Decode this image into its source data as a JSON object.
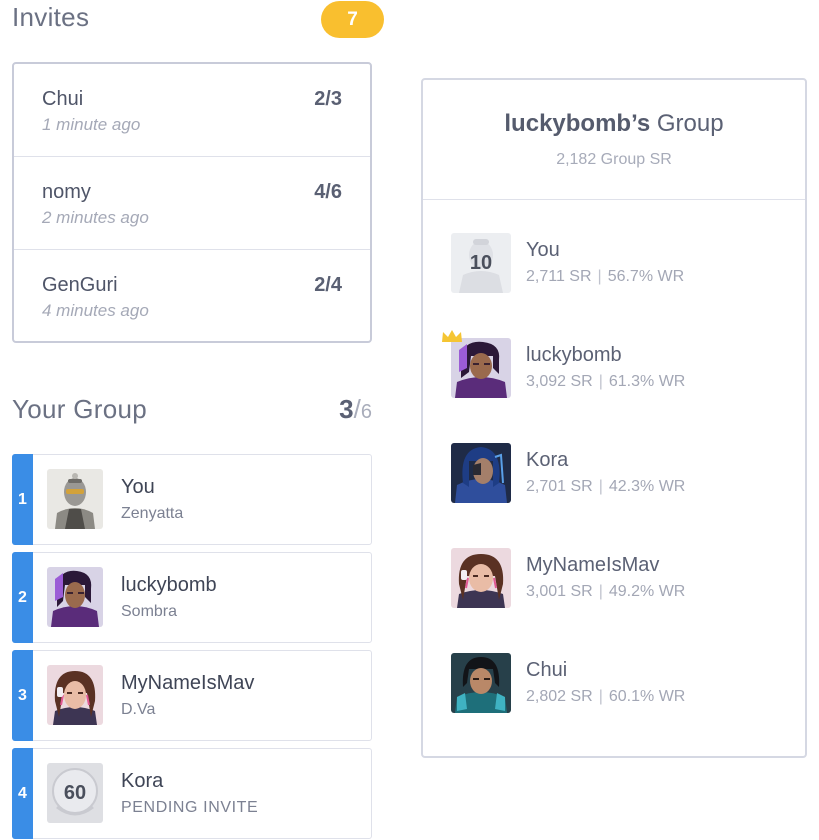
{
  "invites": {
    "title": "Invites",
    "badge_count": "7",
    "items": [
      {
        "name": "Chui",
        "time": "1 minute ago",
        "count": "2/3"
      },
      {
        "name": "nomy",
        "time": "2 minutes ago",
        "count": "4/6"
      },
      {
        "name": "GenGuri",
        "time": "4 minutes ago",
        "count": "2/4"
      }
    ]
  },
  "your_group": {
    "title": "Your Group",
    "current": "3",
    "separator": "/",
    "max": "6",
    "members": [
      {
        "rank": "1",
        "name": "You",
        "sub": "Zenyatta",
        "avatar": "zenyatta-avatar-icon"
      },
      {
        "rank": "2",
        "name": "luckybomb",
        "sub": "Sombra",
        "avatar": "sombra-avatar-icon"
      },
      {
        "rank": "3",
        "name": "MyNameIsMav",
        "sub": "D.Va",
        "avatar": "dva-avatar-icon"
      },
      {
        "rank": "4",
        "name": "Kora",
        "sub": "PENDING INVITE",
        "avatar": "level-badge-icon",
        "level": "60"
      }
    ]
  },
  "group_panel": {
    "owner": "luckybomb’s",
    "title_suffix": " Group",
    "group_sr": "2,182 Group SR",
    "players": [
      {
        "name": "You",
        "sr": "2,711 SR",
        "wr": "56.7% WR",
        "avatar": "level-badge-icon",
        "level": "10"
      },
      {
        "name": "luckybomb",
        "sr": "3,092 SR",
        "wr": "61.3% WR",
        "avatar": "sombra-avatar-icon",
        "leader": true
      },
      {
        "name": "Kora",
        "sr": "2,701 SR",
        "wr": "42.3% WR",
        "avatar": "ana-avatar-icon"
      },
      {
        "name": "MyNameIsMav",
        "sr": "3,001 SR",
        "wr": "49.2% WR",
        "avatar": "dva-avatar-icon"
      },
      {
        "name": "Chui",
        "sr": "2,802 SR",
        "wr": "60.1% WR",
        "avatar": "pharah-avatar-icon"
      }
    ]
  },
  "colors": {
    "accent_blue": "#3a8de6",
    "badge_yellow": "#f9bf2f",
    "crown_gold": "#f5c533"
  }
}
